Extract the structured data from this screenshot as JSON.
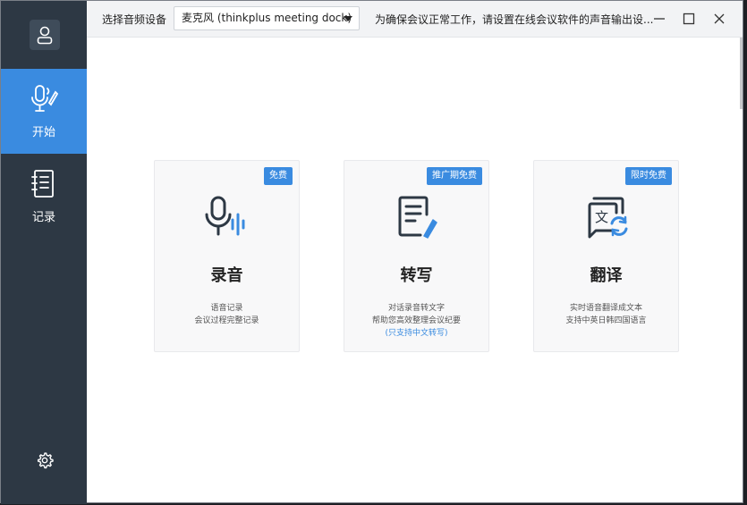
{
  "sidebar": {
    "nav": [
      {
        "label": "开始",
        "icon": "microphone-pen-icon",
        "active": true
      },
      {
        "label": "记录",
        "icon": "notebook-icon",
        "active": false
      }
    ],
    "settings_icon": "gear-icon"
  },
  "topbar": {
    "device_label": "选择音频设备",
    "device_value": "麦克风 (thinkplus meeting dock)",
    "notice": "为确保会议正常工作，请设置在线会议软件的声音输出设..."
  },
  "cards": [
    {
      "badge": "免费",
      "title": "录音",
      "desc": [
        "语音记录",
        "会议过程完整记录"
      ],
      "note": "",
      "icon": "microphone-icon"
    },
    {
      "badge": "推广期免费",
      "title": "转写",
      "desc": [
        "对话录音转文字",
        "帮助您高效整理会议纪要"
      ],
      "note": "(只支持中文转写)",
      "icon": "document-edit-icon"
    },
    {
      "badge": "限时免费",
      "title": "翻译",
      "desc": [
        "实时语音翻译成文本",
        "支持中英日韩四国语言"
      ],
      "note": "",
      "icon": "translate-icon"
    }
  ],
  "colors": {
    "accent": "#3a8be0",
    "sidebar": "#2d3844",
    "icon_dark": "#2d3844"
  }
}
